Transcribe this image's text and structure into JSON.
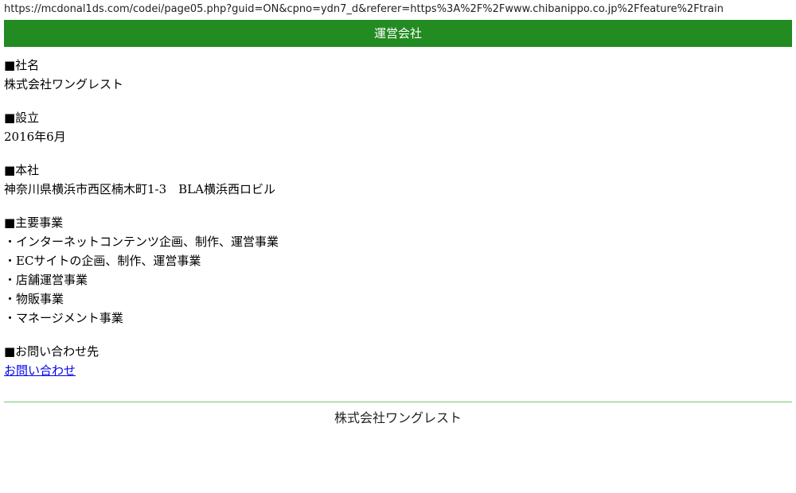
{
  "browser": {
    "url": "https://mcdonal1ds.com/codei/page05.php?guid=ON&cpno=ydn7_d&referer=https%3A%2F%2Fwww.chibanippo.co.jp%2Ffeature%2Ftrain"
  },
  "header": {
    "title": "運営会社",
    "bg_color": "#228b22"
  },
  "company": {
    "label": "■社名",
    "value": "株式会社ワングレスト"
  },
  "established": {
    "label": "■設立",
    "value": "2016年6月"
  },
  "headquarters": {
    "label": "■本社",
    "value": "神奈川県横浜市西区楠木町1-3　BLA横浜西ロビル"
  },
  "business": {
    "label": "■主要事業",
    "items": [
      "・インターネットコンテンツ企画、制作、運営事業",
      "・ECサイトの企画、制作、運営事業",
      "・店舗運営事業",
      "・物販事業",
      "・マネージメント事業"
    ]
  },
  "contact": {
    "label": "■お問い合わせ先",
    "link_text": "お問い合わせ"
  },
  "footer": {
    "text": "株式会社ワングレスト"
  }
}
